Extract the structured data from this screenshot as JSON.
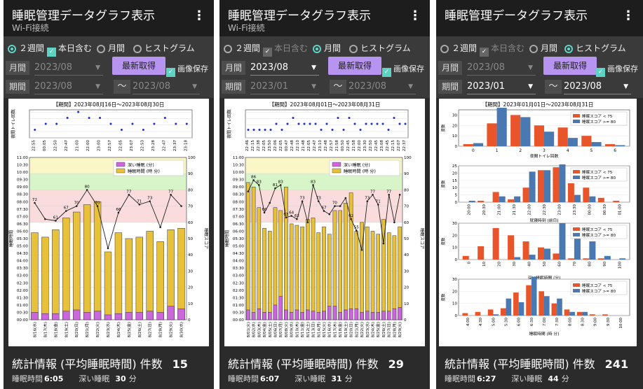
{
  "screens": [
    {
      "title": "睡眠管理データグラフ表示",
      "subtitle": "Wi-Fi接続",
      "radio_2weeks": "２週間",
      "include_today": "本日含む",
      "radio_month": "月間",
      "radio_hist": "ヒストグラム",
      "selected": "2weeks",
      "label_month": "月間",
      "month_value": "2023/08",
      "fetch_label": "最新取得",
      "save_label": "画像保存",
      "label_period": "期間",
      "period_from": "2023/08",
      "period_to": "2023/08",
      "stats_label": "統計情報 (平均睡眠時間) 件数",
      "count": "15",
      "sleep_label": "睡眠時間",
      "sleep_value": "6:05",
      "deep_label": "深い睡眠",
      "deep_value": "30",
      "deep_unit": "分"
    },
    {
      "title": "睡眠管理データグラフ表示",
      "subtitle": "Wi-Fi接続",
      "radio_2weeks": "２週間",
      "include_today": "本日含む",
      "radio_month": "月間",
      "radio_hist": "ヒストグラム",
      "selected": "month",
      "label_month": "月間",
      "month_value": "2023/08",
      "fetch_label": "最新取得",
      "save_label": "画像保存",
      "label_period": "期間",
      "period_from": "2023/01",
      "period_to": "2023/08",
      "stats_label": "統計情報 (平均睡眠時間) 件数",
      "count": "29",
      "sleep_label": "睡眠時間",
      "sleep_value": "6:07",
      "deep_label": "深い睡眠",
      "deep_value": "31",
      "deep_unit": "分"
    },
    {
      "title": "睡眠管理データグラフ表示",
      "subtitle": "",
      "radio_2weeks": "２週間",
      "include_today": "本日含む",
      "radio_month": "月間",
      "radio_hist": "ヒストグラム",
      "selected": "hist",
      "label_month": "月間",
      "month_value": "2023/08",
      "fetch_label": "最新取得",
      "save_label": "画像保存",
      "label_period": "期間",
      "period_from": "2023/01",
      "period_to": "2023/08",
      "stats_label": "統計情報 (平均睡眠時間) 件数",
      "count": "241",
      "sleep_label": "睡眠時間",
      "sleep_value": "6:27",
      "deep_label": "深い睡眠",
      "deep_value": "44",
      "deep_unit": "分"
    }
  ],
  "colors": {
    "deep_sleep": "#cc66dd",
    "sleep_time": "#e8c13a",
    "score_line": "#222222",
    "toilet_dot": "#1f2fcc",
    "hist_low": "#e8552a",
    "hist_high": "#4a78b0",
    "accent": "#5fd3c3",
    "button": "#b794f0"
  },
  "chart_data": [
    {
      "type": "bar",
      "title": "【期間】2023年08月16日～2023年08月30日",
      "toilet_ylabel": "夜間トイレ回数",
      "bedtimes": [
        "22:55",
        "00:05",
        "22:50",
        "22:47",
        "21:00",
        "22:00",
        "23:00",
        "22:57",
        "22:05",
        "23:07",
        "22:53",
        "23:28",
        "22:47",
        "23:37",
        "23:18"
      ],
      "toilet_counts": [
        1,
        2,
        2,
        3,
        4,
        3,
        3,
        2,
        1,
        2,
        1,
        2,
        3,
        2,
        2
      ],
      "categories": [
        "8/16(水)",
        "8/17(木)",
        "8/18(金)",
        "8/19(土)",
        "8/20(日)",
        "8/21(月)",
        "8/22(火)",
        "8/23(水)",
        "8/24(木)",
        "8/25(金)",
        "8/26(土)",
        "8/27(日)",
        "8/28(月)",
        "8/29(火)",
        "8/30(水)"
      ],
      "sleep_hours": [
        5.9,
        5.6,
        6.1,
        6.9,
        7.3,
        7.8,
        8.0,
        4.6,
        5.9,
        5.5,
        5.6,
        6.0,
        5.3,
        6.1,
        6.2
      ],
      "deep_minutes": [
        30,
        25,
        25,
        35,
        40,
        30,
        35,
        20,
        25,
        30,
        30,
        35,
        30,
        55,
        45
      ],
      "scores": [
        72,
        62,
        61,
        67,
        70,
        80,
        70,
        44,
        66,
        77,
        71,
        73,
        57,
        77,
        70
      ],
      "score_labels_shown": [
        72,
        61,
        67,
        70,
        80,
        70,
        66,
        77,
        71,
        73,
        77
      ],
      "legend": [
        "深い睡眠 (分)",
        "睡眠時間 (時 分)"
      ],
      "ylabel_left": "睡眠時間",
      "ylabel_right": "睡眠スコア",
      "y_ticks": [
        "00:00",
        "00:30",
        "01:00",
        "01:30",
        "02:00",
        "02:30",
        "03:00",
        "03:30",
        "04:00",
        "04:30",
        "05:00",
        "05:30",
        "06:00",
        "06:30",
        "07:00",
        "07:30",
        "08:00",
        "08:30",
        "09:00",
        "09:30",
        "10:00",
        "10:30",
        "11:00"
      ],
      "right_ticks": [
        "0",
        "10",
        "20",
        "30",
        "40",
        "50",
        "60",
        "70",
        "80",
        "90",
        "100"
      ]
    },
    {
      "type": "bar",
      "title": "【期間】2023年08月01日～2023年08月31日",
      "toilet_ylabel": "夜間トイレ回数",
      "bedtimes": [
        "22:46",
        "22:15",
        "22:38",
        "22:05",
        "23:50",
        "22:06",
        "22:05",
        "00:47",
        "22:48",
        "22:10",
        "21:48",
        "22:05",
        "22:47",
        "23:10",
        "22:48",
        "22:57",
        "21:58",
        "00:50",
        "22:45",
        "21:58",
        "22:00",
        "23:30",
        "22:50",
        "22:45",
        "23:08",
        "22:45",
        "22:15",
        "22:07",
        "22:37"
      ],
      "toilet_counts": [
        1,
        1,
        1,
        1,
        1,
        2,
        1,
        2,
        3,
        2,
        2,
        2,
        2,
        1,
        2,
        1,
        3,
        1,
        3,
        2,
        1,
        2,
        2,
        2,
        2,
        1,
        3,
        2,
        2
      ],
      "categories": [
        "8/01(火)",
        "8/02(水)",
        "8/03(木)",
        "8/04(金)",
        "8/05(土)",
        "8/06(日)",
        "8/07(月)",
        "8/08(火)",
        "8/09(水)",
        "8/10(木)",
        "8/11(金)",
        "8/12(土)",
        "8/13(日)",
        "8/14(月)",
        "8/15(火)",
        "8/16(水)",
        "8/17(木)",
        "8/18(金)",
        "8/19(土)",
        "8/20(日)",
        "8/21(月)",
        "8/22(火)",
        "8/23(水)",
        "8/24(木)",
        "8/25(金)",
        "8/26(土)",
        "8/27(日)",
        "8/28(月)",
        "8/29(火)"
      ],
      "sleep_hours": [
        9.3,
        9.0,
        7.6,
        6.2,
        6.0,
        7.6,
        7.4,
        9.0,
        6.5,
        6.4,
        6.3,
        6.8,
        6.9,
        5.9,
        6.3,
        5.8,
        7.4,
        7.4,
        7.9,
        8.6,
        6.0,
        6.6,
        6.3,
        6.0,
        5.8,
        6.8,
        5.9,
        5.7,
        6.3
      ],
      "deep_minutes": [
        40,
        30,
        45,
        30,
        30,
        60,
        95,
        40,
        30,
        40,
        30,
        40,
        35,
        30,
        35,
        55,
        55,
        30,
        40,
        45,
        45,
        30,
        35,
        30,
        30,
        35,
        35,
        45,
        50
      ],
      "scores": [
        79,
        86,
        83,
        66,
        72,
        81,
        83,
        63,
        64,
        62,
        73,
        60,
        83,
        73,
        67,
        65,
        70,
        70,
        75,
        62,
        55,
        43,
        73,
        77,
        71,
        47,
        77,
        60,
        77
      ],
      "score_labels_shown": [
        86,
        83,
        81,
        83,
        66,
        63,
        64,
        62,
        73,
        83,
        73,
        67,
        73,
        70,
        62,
        55,
        77,
        71,
        77
      ],
      "legend": [
        "深い睡眠 (分)",
        "睡眠時間 (時 分)"
      ],
      "ylabel_left": "睡眠時間",
      "ylabel_right": "睡眠スコア",
      "y_ticks": [
        "00:00",
        "00:30",
        "01:00",
        "01:30",
        "02:00",
        "02:30",
        "03:00",
        "03:30",
        "04:00",
        "04:30",
        "05:00",
        "05:30",
        "06:00",
        "06:30",
        "07:00",
        "07:30",
        "08:00",
        "08:30",
        "09:00",
        "09:30",
        "10:00",
        "10:30",
        "11:00"
      ],
      "right_ticks": [
        "0",
        "10",
        "20",
        "30",
        "40",
        "50",
        "60",
        "70",
        "80",
        "90",
        "100"
      ]
    },
    {
      "type": "bar",
      "title": "【期間】2023年01月01日～2023年08月31日",
      "legend": [
        "睡眠スコア < 75",
        "睡眠スコア >= 80"
      ],
      "panels": [
        {
          "xlabel": "夜間トイレ回数",
          "ylabel": "度数",
          "categories": [
            "0",
            "1",
            "2",
            "3",
            "4",
            "5",
            "6"
          ],
          "low": [
            2,
            22,
            30,
            20,
            18,
            10,
            2
          ],
          "high": [
            3,
            37,
            28,
            14,
            8,
            4,
            1
          ],
          "ymax": 35,
          "yticks": [
            "0",
            "10",
            "20",
            "30"
          ]
        },
        {
          "xlabel": "就寝時刻 (前日)",
          "ylabel": "度数",
          "categories": [
            "20:00",
            "20:30",
            "21:00",
            "21:30",
            "22:00",
            "22:30",
            "23:00",
            "23:30",
            "00:00",
            "00:30",
            "01:00"
          ],
          "low": [
            0,
            1,
            7,
            2,
            10,
            22,
            24,
            13,
            10,
            3,
            1
          ],
          "high": [
            1,
            0,
            4,
            4,
            21,
            22,
            26,
            5,
            4,
            0,
            0
          ],
          "ymax": 25,
          "yticks": [
            "0",
            "5",
            "10",
            "15",
            "20",
            "25"
          ]
        },
        {
          "xlabel": "深い睡眠時間 (分)",
          "ylabel": "度数",
          "categories": [
            "0",
            "10",
            "20",
            "30",
            "40",
            "50",
            "60",
            "70",
            "80",
            "90",
            "100"
          ],
          "low": [
            3,
            11,
            26,
            20,
            15,
            10,
            5,
            1,
            1,
            1,
            0
          ],
          "high": [
            0,
            0,
            0,
            2,
            4,
            9,
            30,
            20,
            15,
            3,
            1
          ],
          "ymax": 30,
          "yticks": [
            "0",
            "10",
            "20",
            "30"
          ]
        },
        {
          "xlabel": "睡眠時間 (時 分)",
          "ylabel": "度数",
          "categories": [
            "4:00",
            "4:30",
            "5:00",
            "5:30",
            "6:00",
            "6:30",
            "7:00",
            "7:30",
            "8:00",
            "8:30",
            "9:00",
            "9:30",
            "10:00"
          ],
          "low": [
            2,
            3,
            5,
            6,
            19,
            25,
            20,
            10,
            5,
            3,
            1,
            1,
            0
          ],
          "high": [
            0,
            0,
            1,
            14,
            11,
            32,
            16,
            14,
            3,
            3,
            0,
            0,
            0
          ],
          "ymax": 30,
          "yticks": [
            "0",
            "10",
            "20",
            "30"
          ]
        }
      ]
    }
  ]
}
